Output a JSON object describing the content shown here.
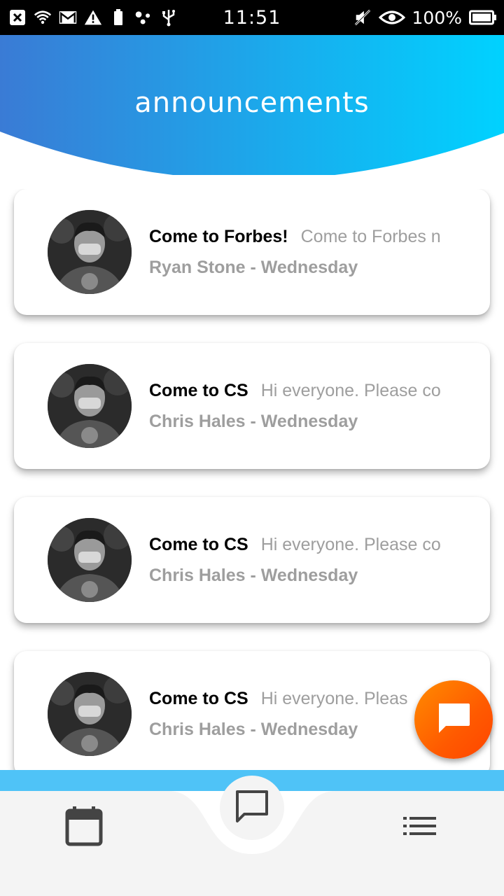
{
  "status_bar": {
    "time": "11:51",
    "battery_percent": "100%",
    "icons_left": [
      "close-box-icon",
      "wifi-icon",
      "gmail-icon",
      "warning-icon",
      "battery-small-icon",
      "dots-icon",
      "usb-icon"
    ],
    "icons_right": [
      "mute-icon",
      "eye-icon",
      "battery-icon"
    ]
  },
  "header": {
    "title": "announcements",
    "gradient_start": "#3a7bd5",
    "gradient_end": "#00d2ff"
  },
  "announcements": [
    {
      "title": "Come to Forbes!",
      "preview": "Come to Forbes n",
      "author_line": "Ryan Stone - Wednesday"
    },
    {
      "title": "Come to CS",
      "preview": "Hi everyone. Please co",
      "author_line": "Chris Hales - Wednesday"
    },
    {
      "title": "Come to CS",
      "preview": "Hi everyone. Please co",
      "author_line": "Chris Hales - Wednesday"
    },
    {
      "title": "Come to CS",
      "preview": "Hi everyone. Pleas",
      "author_line": "Chris Hales - Wednesday"
    }
  ],
  "fab": {
    "icon": "chat-bubble-icon",
    "color": "#ff6a00"
  },
  "bottom_nav": {
    "accent": "#4fc3f7",
    "items": [
      {
        "icon": "calendar-icon"
      },
      {
        "icon": "message-icon",
        "active": true
      },
      {
        "icon": "list-icon"
      }
    ]
  }
}
